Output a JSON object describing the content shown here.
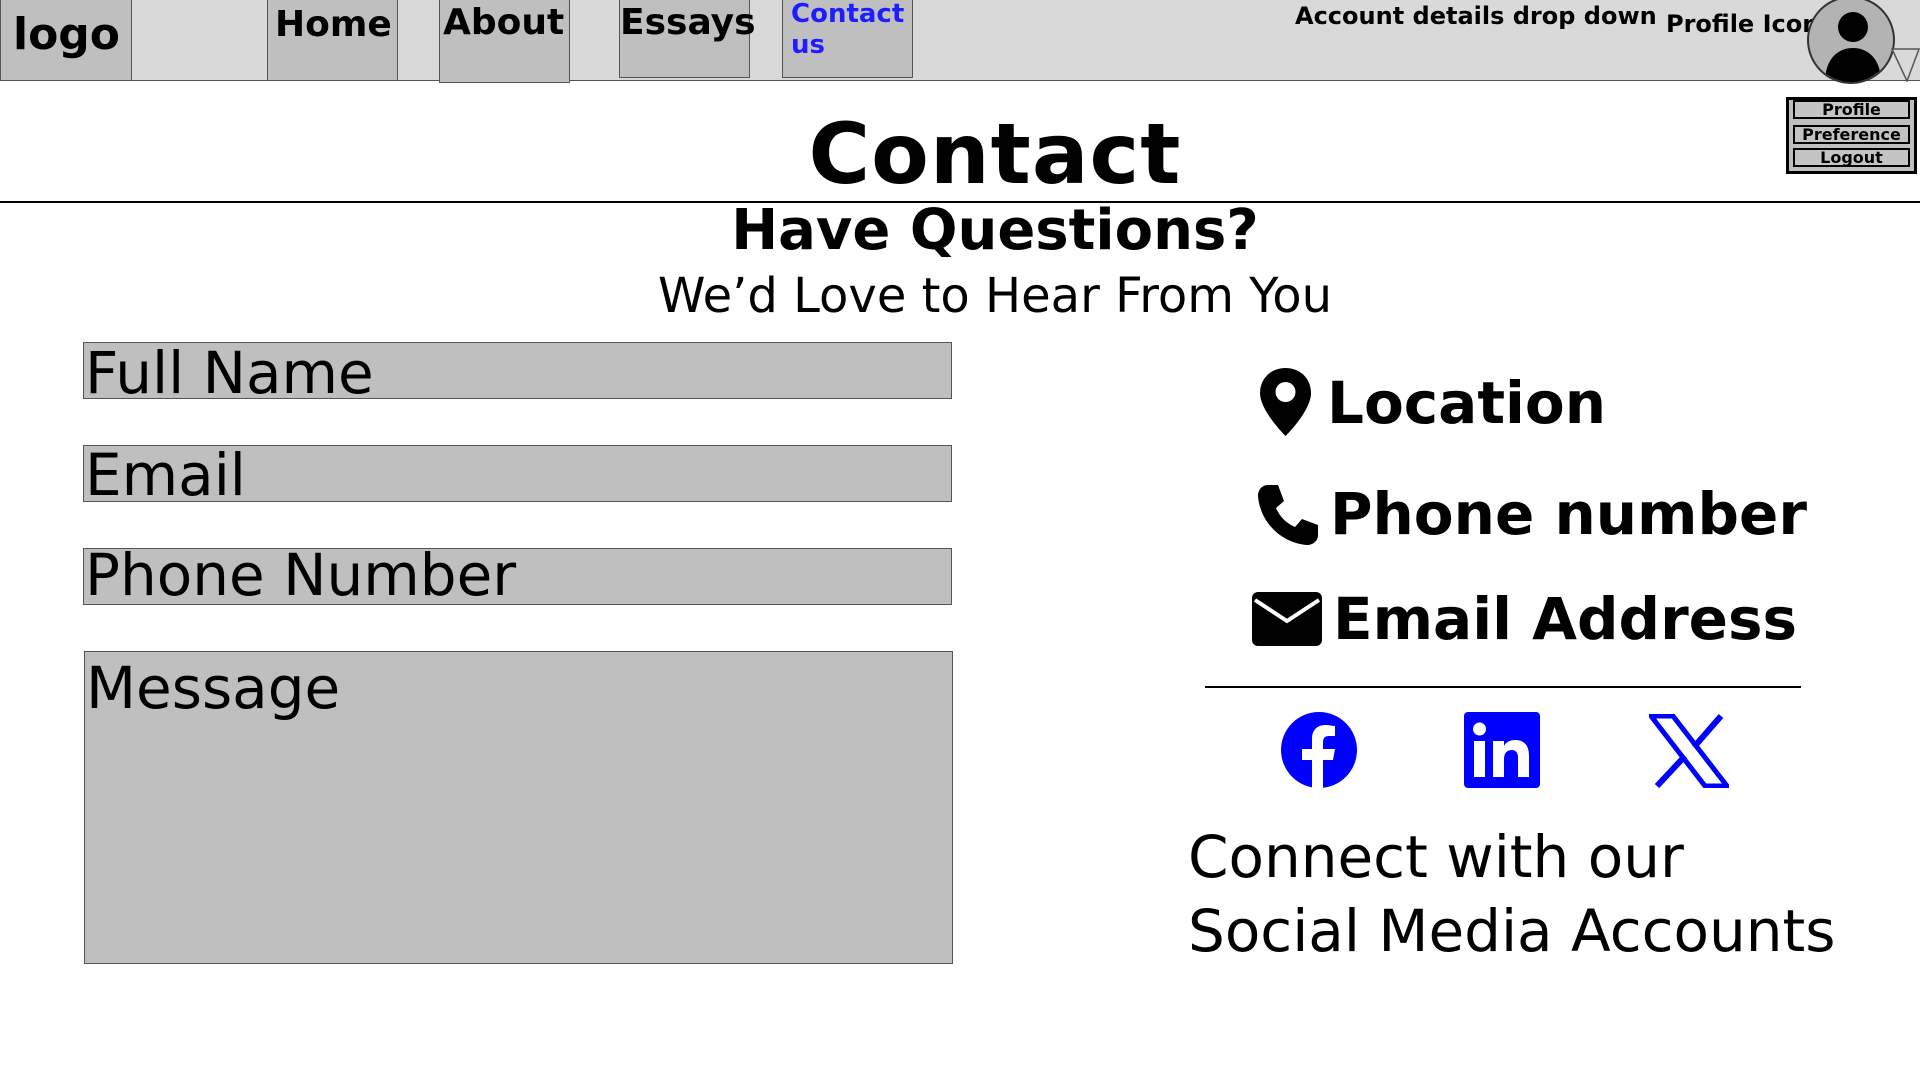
{
  "nav": {
    "logo": "logo",
    "home": "Home",
    "about": "About",
    "essays": "Essays",
    "contact": "Contact us",
    "account_label": "Account details drop down",
    "profile_label": "Profile Icon"
  },
  "account_menu": {
    "items": [
      "Profile",
      "Preference",
      "Logout"
    ]
  },
  "header": {
    "title": "Contact",
    "subtitle": "Have Questions?",
    "tagline": "We’d Love to Hear From You"
  },
  "form": {
    "full_name": "Full Name",
    "email": "Email",
    "phone": "Phone Number",
    "message": "Message"
  },
  "contact_info": {
    "location": "Location",
    "phone": "Phone number",
    "email": "Email Address"
  },
  "social": {
    "icons": [
      "facebook-icon",
      "linkedin-icon",
      "x-icon"
    ],
    "text_line1": "Connect with our",
    "text_line2": "Social Media Accounts"
  },
  "colors": {
    "nav_bg": "#d9d9d9",
    "box_bg": "#bfbfbf",
    "link_blue": "#1d1dff",
    "social_blue": "#0000ff"
  }
}
